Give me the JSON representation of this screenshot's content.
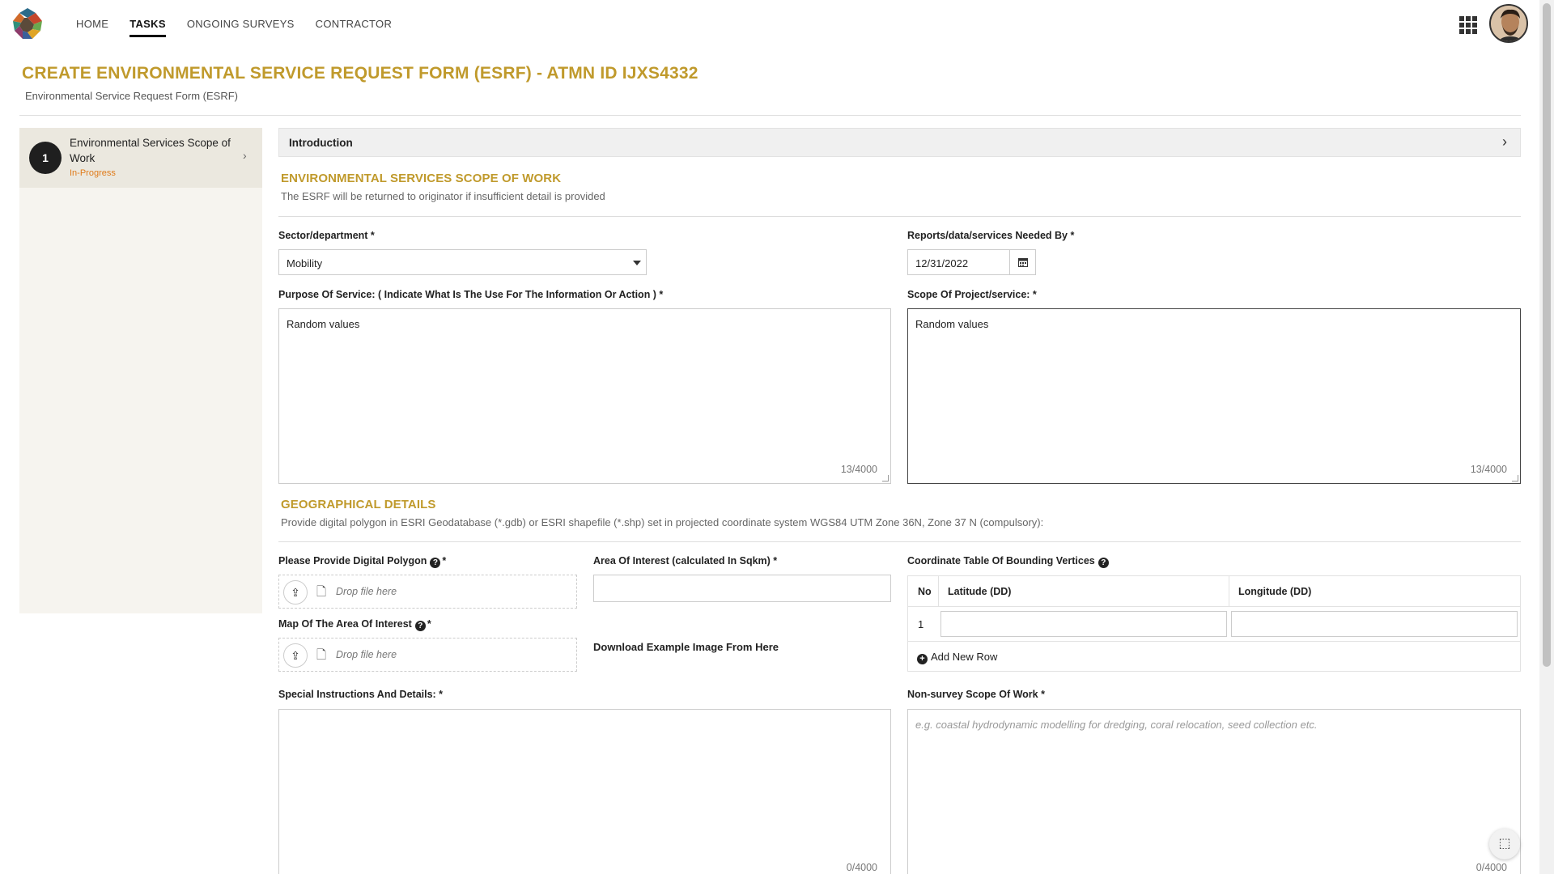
{
  "nav": {
    "items": [
      "HOME",
      "TASKS",
      "ONGOING SURVEYS",
      "CONTRACTOR"
    ],
    "active": "TASKS"
  },
  "header": {
    "title": "CREATE ENVIRONMENTAL SERVICE REQUEST FORM (ESRF) - ATMN ID IJXS4332",
    "subtitle": "Environmental Service Request Form (ESRF)"
  },
  "steps": [
    {
      "number": "1",
      "title": "Environmental Services Scope of Work",
      "status": "In-Progress"
    }
  ],
  "intro": {
    "label": "Introduction"
  },
  "scope_section": {
    "title": "ENVIRONMENTAL SERVICES SCOPE OF WORK",
    "subtitle": "The ESRF will be returned to originator if insufficient detail is provided"
  },
  "fields": {
    "sector": {
      "label": "Sector/department *",
      "value": "Mobility"
    },
    "needed_by": {
      "label": "Reports/data/services Needed By *",
      "value": "12/31/2022"
    },
    "purpose": {
      "label": "Purpose Of Service: ( Indicate What Is The Use For The Information Or Action ) *",
      "value": "Random values",
      "count": "13/4000"
    },
    "scope": {
      "label": "Scope Of Project/service: *",
      "value": "Random values",
      "count": "13/4000"
    },
    "polygon": {
      "label": "Please Provide Digital Polygon",
      "required": "*",
      "drop_text": "Drop file here"
    },
    "area": {
      "label": "Area Of Interest (calculated In Sqkm) *",
      "value": ""
    },
    "map": {
      "label": "Map Of The Area Of Interest",
      "required": "*",
      "drop_text": "Drop file here"
    },
    "download_link": "Download Example Image From Here",
    "special": {
      "label": "Special Instructions And Details: *",
      "value": "",
      "count": "0/4000"
    },
    "non_survey": {
      "label": "Non-survey Scope Of Work *",
      "placeholder": "e.g. coastal hydrodynamic modelling for dredging, coral relocation, seed collection etc.",
      "count": "0/4000"
    }
  },
  "geo_section": {
    "title": "GEOGRAPHICAL DETAILS",
    "subtitle": "Provide digital polygon in ESRI Geodatabase (*.gdb) or ESRI shapefile (*.shp)  set in projected coordinate system WGS84 UTM Zone 36N, Zone 37 N (compulsory):"
  },
  "coord_table": {
    "label": "Coordinate Table Of Bounding Vertices",
    "headers": [
      "No",
      "Latitude (DD)",
      "Longitude (DD)"
    ],
    "rows": [
      {
        "no": "1",
        "lat": "",
        "lon": ""
      }
    ],
    "add_row": "Add New Row"
  },
  "colors": {
    "accent": "#c09a2c",
    "status": "#e07b1a"
  }
}
